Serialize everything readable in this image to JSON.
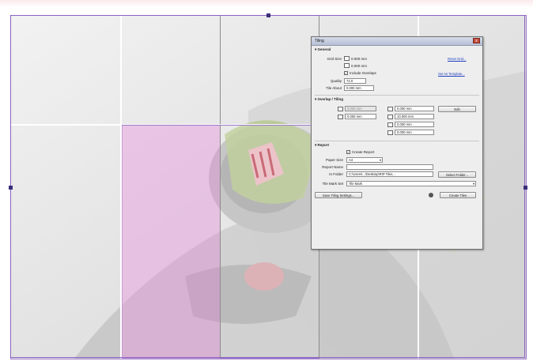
{
  "dialog": {
    "title": "Tiling",
    "close_glyph": "x",
    "section_general": "General",
    "label_grid_size": "Grid Size",
    "grid_width": "0.000 mm",
    "grid_height": "0.000 mm",
    "link_reset_grid": "Reset Grid...",
    "include_overlaps": "Include Overlaps",
    "link_set_as_template": "Set As Template...",
    "label_quality": "Quality",
    "quality_value": "72.0",
    "label_tile_about": "Tile About",
    "tile_about_value": "0.000 mm",
    "section_overlap": "Overlap / Tiling",
    "overlap_h": "0.000 mm",
    "overlap_v": "0.000 mm",
    "margin_top": "0.000 mm",
    "margin_bottom": "10.000 mm",
    "margin_left": "0.000 mm",
    "margin_right": "0.000 mm",
    "edit_button": "Edit",
    "section_report": "Report",
    "create_report": "Create Report",
    "label_paper_size": "Paper Size",
    "paper_size_value": "A4",
    "label_report_name": "Report Name",
    "report_name_value": "",
    "label_in_folder": "In Folder",
    "folder_value": "C:\\Users\\...\\Desktop\\RIP Tiles...",
    "select_folder_button": "Select Folder...",
    "label_tile_mark": "Tile Mark Set",
    "tile_mark_value": "Tile Mark",
    "save_settings_button": "Save Tiling Settings...",
    "create_tiles_button": "Create Tiles"
  }
}
